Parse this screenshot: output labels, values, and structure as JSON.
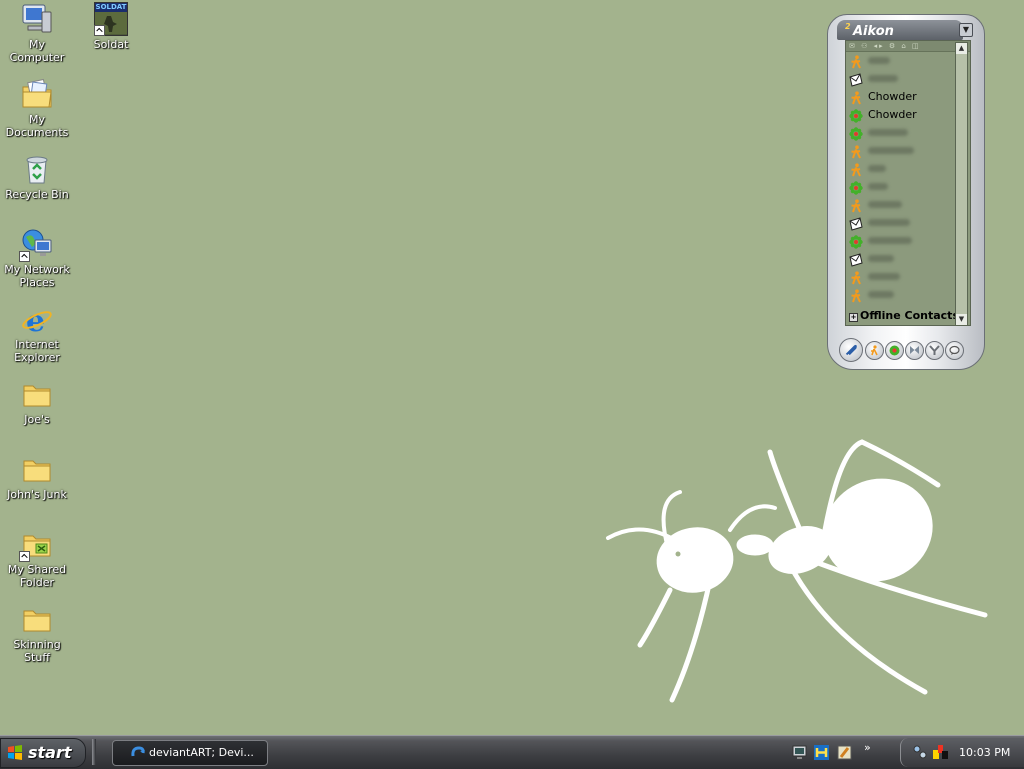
{
  "desktop": {
    "icons": [
      {
        "label": "My Computer"
      },
      {
        "label": "Soldat"
      },
      {
        "label": "My Documents"
      },
      {
        "label": "Recycle Bin"
      },
      {
        "label": "My Network Places"
      },
      {
        "label": "Internet Explorer"
      },
      {
        "label": "Joe's"
      },
      {
        "label": "John's Junk"
      },
      {
        "label": "My Shared Folder"
      },
      {
        "label": "Skinning Stuff"
      }
    ],
    "soldat_icon_text": "SOLDAT",
    "background_color": "#a3b38d"
  },
  "aikon": {
    "title": "Aikon",
    "title_superscript": "2",
    "column_icons": "✉ ⚇ ◂▸ ⚙ ⌂ ◫",
    "contacts": [
      {
        "protocol": "aim",
        "name": "",
        "hidden": true
      },
      {
        "protocol": "msn",
        "name": "",
        "hidden": true
      },
      {
        "protocol": "aim",
        "name": "Chowder",
        "hidden": false
      },
      {
        "protocol": "icq",
        "name": "Chowder",
        "hidden": false
      },
      {
        "protocol": "icq",
        "name": "",
        "hidden": true
      },
      {
        "protocol": "aim",
        "name": "",
        "hidden": true
      },
      {
        "protocol": "aim",
        "name": "",
        "hidden": true
      },
      {
        "protocol": "icq",
        "name": "",
        "hidden": true
      },
      {
        "protocol": "aim",
        "name": "",
        "hidden": true
      },
      {
        "protocol": "msn",
        "name": "",
        "hidden": true
      },
      {
        "protocol": "icq",
        "name": "",
        "hidden": true
      },
      {
        "protocol": "msn",
        "name": "",
        "hidden": true
      },
      {
        "protocol": "aim",
        "name": "",
        "hidden": true
      },
      {
        "protocol": "aim",
        "name": "",
        "hidden": true
      }
    ],
    "offline_group": "Offline Contacts",
    "offline_expander": "+"
  },
  "taskbar": {
    "start_label": "start",
    "task_button": "deviantART; Devi...",
    "clock": "10:03 PM",
    "chevron": "»"
  }
}
